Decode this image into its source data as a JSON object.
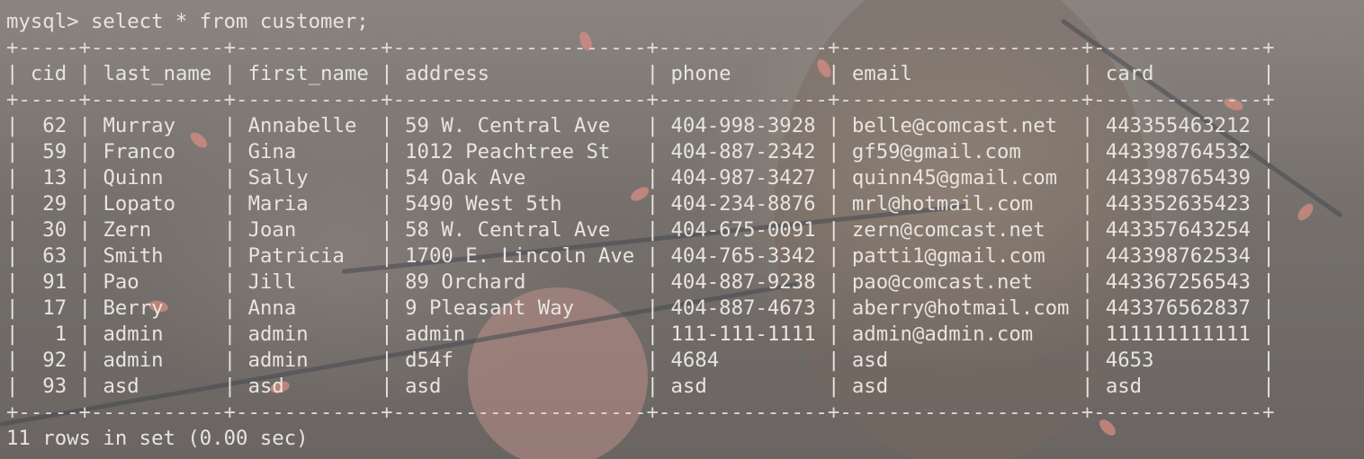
{
  "prompt": "mysql> select * from customer;",
  "table": {
    "columns": [
      "cid",
      "last_name",
      "first_name",
      "address",
      "phone",
      "email",
      "card"
    ],
    "rows": [
      [
        "62",
        "Murray",
        "Annabelle",
        "59 W. Central Ave",
        "404-998-3928",
        "belle@comcast.net",
        "443355463212"
      ],
      [
        "59",
        "Franco",
        "Gina",
        "1012 Peachtree St",
        "404-887-2342",
        "gf59@gmail.com",
        "443398764532"
      ],
      [
        "13",
        "Quinn",
        "Sally",
        "54 Oak Ave",
        "404-987-3427",
        "quinn45@gmail.com",
        "443398765439"
      ],
      [
        "29",
        "Lopato",
        "Maria",
        "5490 West 5th",
        "404-234-8876",
        "mrl@hotmail.com",
        "443352635423"
      ],
      [
        "30",
        "Zern",
        "Joan",
        "58 W. Central Ave",
        "404-675-0091",
        "zern@comcast.net",
        "443357643254"
      ],
      [
        "63",
        "Smith",
        "Patricia",
        "1700 E. Lincoln Ave",
        "404-765-3342",
        "patti1@gmail.com",
        "443398762534"
      ],
      [
        "91",
        "Pao",
        "Jill",
        "89 Orchard",
        "404-887-9238",
        "pao@comcast.net",
        "443367256543"
      ],
      [
        "17",
        "Berry",
        "Anna",
        "9 Pleasant Way",
        "404-887-4673",
        "aberry@hotmail.com",
        "443376562837"
      ],
      [
        "1",
        "admin",
        "admin",
        "admin",
        "111-111-1111",
        "admin@admin.com",
        "111111111111"
      ],
      [
        "92",
        "admin",
        "admin",
        "d54f",
        "4684",
        "asd",
        "4653"
      ],
      [
        "93",
        "asd",
        "asd",
        "asd",
        "asd",
        "asd",
        "asd"
      ]
    ]
  },
  "result_summary": "11 rows in set (0.00 sec)",
  "colors": {
    "text": "#e8e4e0",
    "petal": "#d78c82"
  }
}
